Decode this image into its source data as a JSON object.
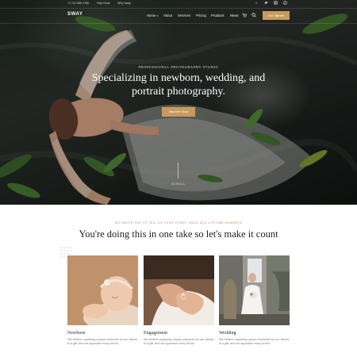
{
  "topbar": {
    "phone": "+1 212 666 2766",
    "help": "Help Desk",
    "why": "Why Sway",
    "social_icons": [
      "facebook-icon",
      "twitter-icon",
      "instagram-icon",
      "pinterest-icon"
    ]
  },
  "header": {
    "logo": "SWAY",
    "nav": [
      {
        "label": "Home",
        "has_dropdown": true
      },
      {
        "label": "About",
        "has_dropdown": false
      },
      {
        "label": "Services",
        "has_dropdown": false
      },
      {
        "label": "Pricing",
        "has_dropdown": false
      },
      {
        "label": "Products",
        "has_dropdown": false
      },
      {
        "label": "News",
        "has_dropdown": false
      }
    ],
    "cta_label": "Get Started"
  },
  "hero": {
    "eyebrow": "PROFESSIONAL PHOTOGRAPHY STUDIO",
    "headline": "Specializing in newborn, wedding, and portrait photography.",
    "button_label": "Discover Now",
    "scroll_label": "SCROLL"
  },
  "section": {
    "eyebrow": "WE INVITE YOU TO TELL US YOUR STORY, ONCE IN A LIFETIME MOMENTS",
    "title": "You're doing this in one take so let's make it count"
  },
  "cards": [
    {
      "title": "Newborn",
      "desc": "We believe capturing unique moments for our clients is a gift, and we approach every shoot"
    },
    {
      "title": "Engagement",
      "desc": "We believe capturing unique moments for our clients is a gift, and we approach every shoot"
    },
    {
      "title": "Wedding",
      "desc": "We believe capturing unique moments for our clients is a gift, and we approach every shoot"
    }
  ],
  "colors": {
    "accent": "#c79a5e",
    "hero_dark": "#1d2620",
    "heading_text": "#242424",
    "body_text": "#7a7a7a"
  }
}
